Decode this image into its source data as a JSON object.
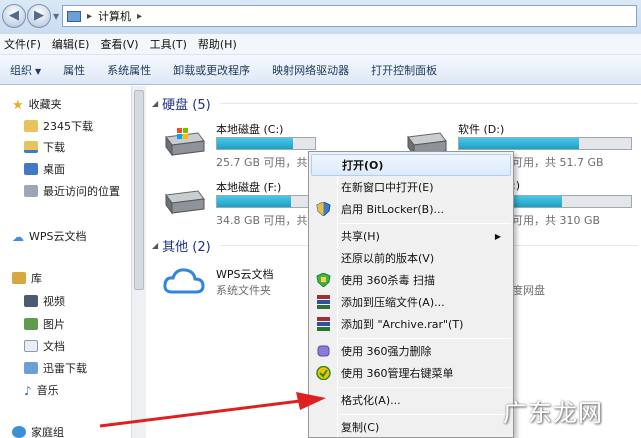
{
  "window": {
    "breadcrumb_separator": "▸",
    "breadcrumb": "计算机",
    "breadcrumb_trailing": "▸"
  },
  "menubar": [
    "文件(F)",
    "编辑(E)",
    "查看(V)",
    "工具(T)",
    "帮助(H)"
  ],
  "commandbar": {
    "organize": "组织",
    "items": [
      "属性",
      "系统属性",
      "卸载或更改程序",
      "映射网络驱动器",
      "打开控制面板"
    ]
  },
  "nav": {
    "favorites": "收藏夹",
    "fav_items": [
      "2345下载",
      "下载",
      "桌面",
      "最近访问的位置"
    ],
    "wps": "WPS云文档",
    "library": "库",
    "lib_items": [
      "视频",
      "图片",
      "文档",
      "迅雷下载",
      "音乐"
    ],
    "homegroup": "家庭组"
  },
  "groups": {
    "hdd": "硬盘 (5)",
    "other": "其他 (2)"
  },
  "drives": [
    {
      "name": "本地磁盘 (C:)",
      "info": "25.7 GB 可用，共",
      "used_fraction": 0.78
    },
    {
      "name": "软件 (D:)",
      "info": "可用，共 51.7 GB",
      "used_fraction": 0.7
    },
    {
      "name": "本地磁盘 (F:)",
      "info": "34.8 GB 可用，共",
      "used_fraction": 0.75
    },
    {
      "name": ":)",
      "info": "可用，共 310 GB",
      "used_fraction": 0.6
    }
  ],
  "other_items": [
    {
      "name": "WPS云文档",
      "desc": "系统文件夹"
    },
    {
      "name": "",
      "desc": "度网盘"
    }
  ],
  "context_menu": [
    {
      "label": "打开(O)",
      "bold": true,
      "highlight": true
    },
    {
      "label": "在新窗口中打开(E)"
    },
    {
      "label": "启用 BitLocker(B)...",
      "icon": "shield-icon"
    },
    {
      "label": "共享(H)",
      "submenu": true
    },
    {
      "label": "还原以前的版本(V)"
    },
    {
      "label": "使用 360杀毒 扫描",
      "icon": "360-antivirus-icon"
    },
    {
      "label": "添加到压缩文件(A)...",
      "icon": "winrar-icon"
    },
    {
      "label": "添加到 \"Archive.rar\"(T)",
      "icon": "winrar-icon"
    },
    {
      "label": "使用 360强力删除",
      "icon": "360-delete-icon"
    },
    {
      "label": "使用 360管理右键菜单",
      "icon": "360-manage-icon"
    },
    {
      "label": "格式化(A)..."
    },
    {
      "label": "复制(C)"
    }
  ],
  "watermark": "广东龙网",
  "colors": {
    "accent": "#1e3287",
    "bar_fill": "#26a6cc",
    "highlight": "#dcebfb",
    "arrow": "#e02020"
  }
}
